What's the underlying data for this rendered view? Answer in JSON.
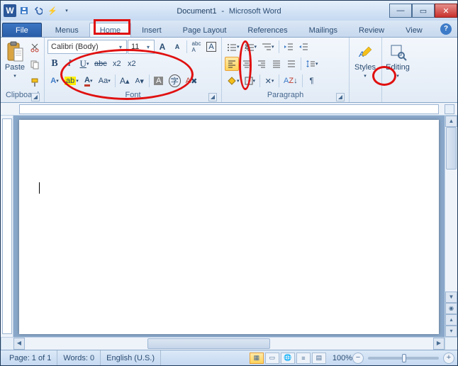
{
  "title": {
    "doc": "Document1",
    "app": "Microsoft Word"
  },
  "qat": {
    "save": "save",
    "undo": "undo",
    "redo": "redo"
  },
  "tabs": [
    "File",
    "Menus",
    "Home",
    "Insert",
    "Page Layout",
    "References",
    "Mailings",
    "Review",
    "View"
  ],
  "active_tab": "Home",
  "clipboard": {
    "paste": "Paste",
    "label": "Clipboard"
  },
  "font": {
    "label": "Font",
    "name": "Calibri (Body)",
    "size": "11",
    "grow": "A",
    "shrink": "A",
    "changecase": "Aa",
    "clear": "A"
  },
  "paragraph": {
    "label": "Paragraph"
  },
  "styles": {
    "label": "Styles",
    "big": "Styles"
  },
  "editing": {
    "label": "Editing",
    "big": "Editing"
  },
  "status": {
    "page": "Page: 1 of 1",
    "words": "Words: 0",
    "lang": "English (U.S.)",
    "zoom": "100%"
  }
}
